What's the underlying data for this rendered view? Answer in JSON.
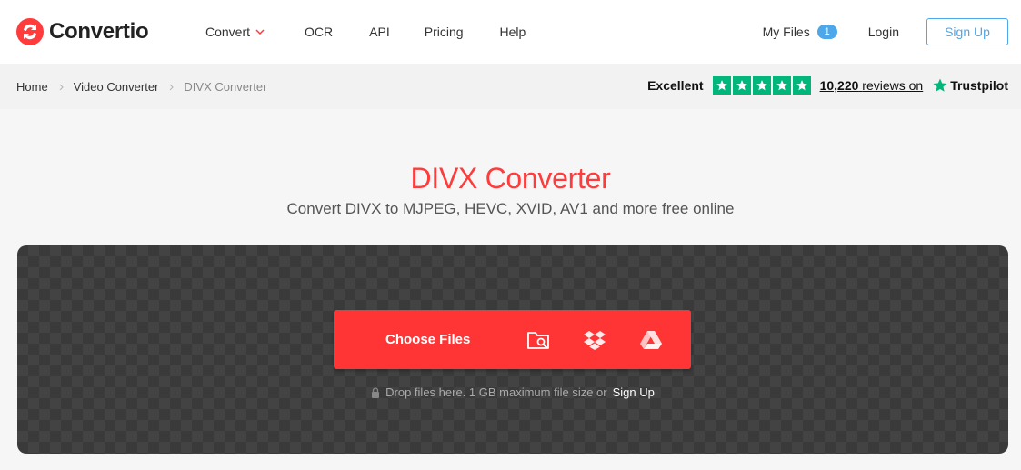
{
  "header": {
    "brand": "Convertio",
    "nav": [
      {
        "label": "Convert"
      },
      {
        "label": "OCR"
      },
      {
        "label": "API"
      },
      {
        "label": "Pricing"
      },
      {
        "label": "Help"
      }
    ],
    "my_files_label": "My Files",
    "my_files_count": "1",
    "login_label": "Login",
    "signup_label": "Sign Up"
  },
  "breadcrumb": {
    "items": [
      "Home",
      "Video Converter",
      "DIVX Converter"
    ]
  },
  "trustpilot": {
    "rating_word": "Excellent",
    "review_count": "10,220",
    "reviews_suffix": "reviews on",
    "brand": "Trustpilot",
    "stars": 5
  },
  "hero": {
    "title": "DIVX Converter",
    "subtitle": "Convert DIVX to MJPEG, HEVC, XVID, AV1 and more free online"
  },
  "upload": {
    "choose_label": "Choose Files",
    "sources": [
      "folder-search-icon",
      "dropbox-icon",
      "google-drive-icon"
    ],
    "drop_note": "Drop files here. 1 GB maximum file size or",
    "drop_signup": "Sign Up"
  },
  "colors": {
    "brand_red": "#ff3535",
    "accent_blue": "#4da7e8",
    "trustpilot_green": "#00b67a",
    "dropzone_bg": "#3a3a3a"
  }
}
